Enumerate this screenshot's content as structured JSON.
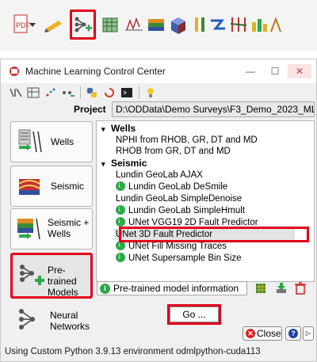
{
  "top_toolbar": {
    "icons": [
      "pdf-export-icon",
      "dropdown-arrow-icon",
      "pencil-icon",
      "machine-learning-icon",
      "attribute-cube-icon",
      "well-log-icon",
      "horizon-layers-icon",
      "volume-cube-icon",
      "well-ties-icon",
      "flow-arrow-icon",
      "fault-icon",
      "bar-chart-icon"
    ]
  },
  "window": {
    "title": "Machine Learning Control Center",
    "minimize_label": "—",
    "maximize_label": "☐",
    "close_label": "✕"
  },
  "project": {
    "label": "Project",
    "path": "D:\\ODData\\Demo Surveys\\F3_Demo_2023_ML"
  },
  "categories": [
    {
      "name": "Wells",
      "label": "Wells"
    },
    {
      "name": "Seismic",
      "label": "Seismic"
    },
    {
      "name": "Seismic + Wells",
      "label": "Seismic +\nWells"
    },
    {
      "name": "Pre-trained Models",
      "label": "Pre-trained\nModels"
    },
    {
      "name": "Neural Networks",
      "label": "Neural\nNetworks"
    }
  ],
  "tree": {
    "wells_header": "Wells",
    "seismic_header": "Seismic",
    "items": [
      {
        "label": "NPHI from RHOB, GR, DT and MD",
        "download": false
      },
      {
        "label": "RHOB from GR, DT and MD",
        "download": false
      },
      {
        "label": "Lundin GeoLab AJAX",
        "download": false
      },
      {
        "label": "Lundin GeoLab DeSmile",
        "download": true
      },
      {
        "label": "Lundin GeoLab SimpleDenoise",
        "download": false
      },
      {
        "label": "Lundin GeoLab SimpleHmult",
        "download": true
      },
      {
        "label": "UNet VGG19 2D Fault Predictor",
        "download": true
      },
      {
        "label": "UNet 3D Fault Predictor",
        "download": false,
        "selected": true
      },
      {
        "label": "UNet Fill Missing Traces",
        "download": true
      },
      {
        "label": "UNet Supersample Bin Size",
        "download": true
      }
    ]
  },
  "buttons": {
    "info": "Pre-trained model information",
    "go": "Go ...",
    "close": "Close",
    "help": "?",
    "more": "▷"
  },
  "status": "Using Custom Python 3.9.13 environment odmlpython-cuda113",
  "colors": {
    "highlight": "#e0001b",
    "download_green": "#2fa84a"
  }
}
